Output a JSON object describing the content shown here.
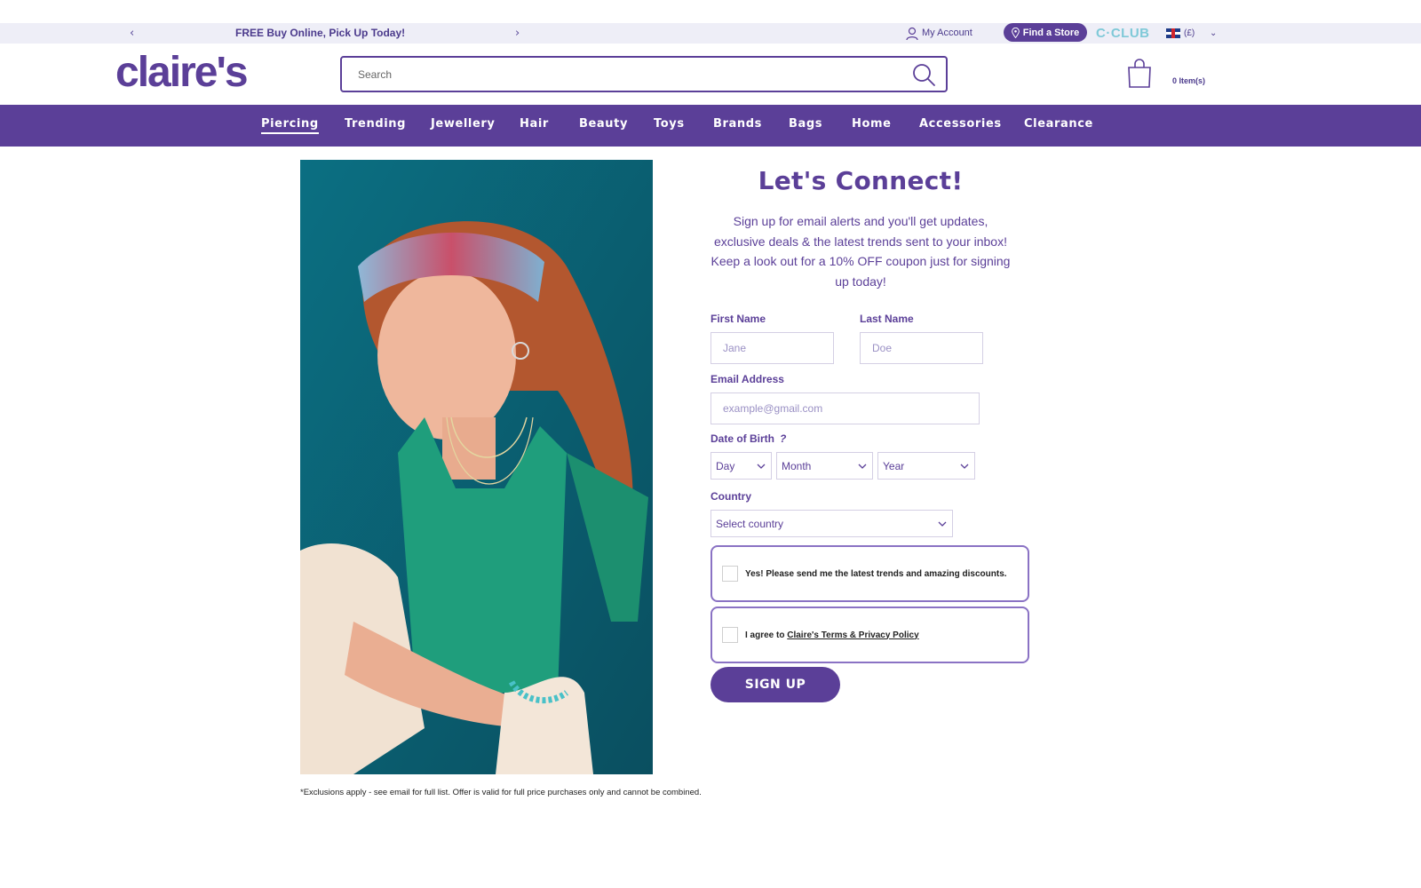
{
  "promo": {
    "prev_arrow": "‹",
    "text": "FREE Buy Online, Pick Up Today!",
    "next_arrow": "›"
  },
  "utility": {
    "account_label": "My Account",
    "find_store_label": "Find a Store",
    "club_label": "C·CLUB",
    "currency_label": "(£)",
    "locale_chevron": "⌄"
  },
  "header": {
    "logo_text": "claire's",
    "search_placeholder": "Search",
    "cart_label": "0 Item(s)"
  },
  "nav": {
    "items": [
      {
        "label": "Piercing"
      },
      {
        "label": "Trending"
      },
      {
        "label": "Jewellery"
      },
      {
        "label": "Hair"
      },
      {
        "label": "Beauty"
      },
      {
        "label": "Toys"
      },
      {
        "label": "Brands"
      },
      {
        "label": "Bags"
      },
      {
        "label": "Home"
      },
      {
        "label": "Accessories"
      },
      {
        "label": "Clearance"
      }
    ],
    "active": "Piercing"
  },
  "form": {
    "title": "Let's Connect!",
    "intro": "Sign up for email alerts and you'll get updates, exclusive deals & the latest trends sent to your inbox! Keep a look out for a 10% OFF coupon just for signing up today!",
    "first_name_label": "First Name",
    "first_name_placeholder": "Jane",
    "last_name_label": "Last Name",
    "last_name_placeholder": "Doe",
    "email_label": "Email Address",
    "email_placeholder": "example@gmail.com",
    "dob_label": "Date of Birth",
    "dob_help": "?",
    "day_value": "Day",
    "month_value": "Month",
    "year_value": "Year",
    "country_label": "Country",
    "country_value": "Select country",
    "marketing_consent": "Yes! Please send me the latest trends and amazing discounts.",
    "terms_prefix": "I agree to ",
    "terms_link": "Claire's Terms & Privacy Policy",
    "submit_label": "SIGN UP"
  },
  "disclaimer": "*Exclusions apply - see email for full list. Offer is valid for full price purchases only and cannot be combined.",
  "colors": {
    "brand_purple": "#5b3f98",
    "promo_bg": "#eeeef7",
    "club_teal": "#7fc9d8",
    "panel_border": "#8a72c4"
  }
}
